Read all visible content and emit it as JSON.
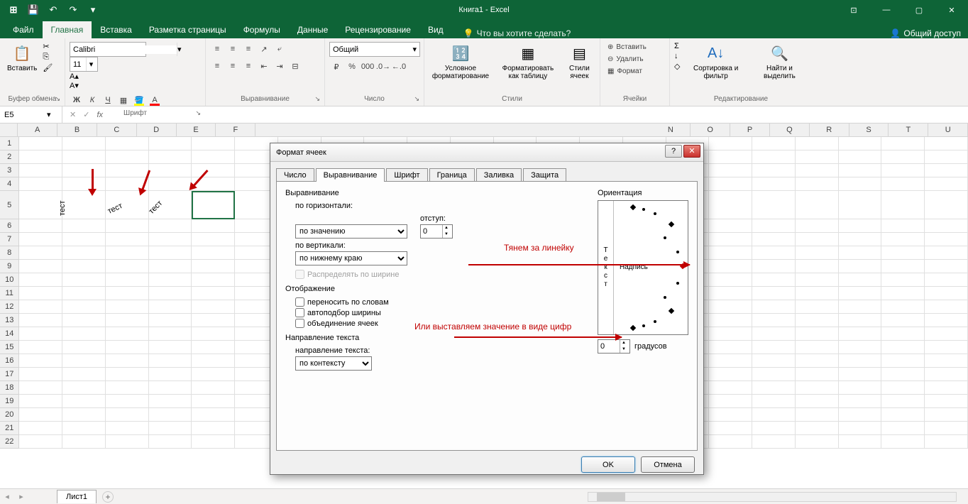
{
  "app": {
    "title": "Книга1 - Excel"
  },
  "qat": {
    "save": "💾",
    "undo": "↶",
    "redo": "↷"
  },
  "tabs": {
    "file": "Файл",
    "home": "Главная",
    "insert": "Вставка",
    "layout": "Разметка страницы",
    "formulas": "Формулы",
    "data": "Данные",
    "review": "Рецензирование",
    "view": "Вид",
    "tell": "Что вы хотите сделать?",
    "share": "Общий доступ"
  },
  "ribbon": {
    "clipboard": {
      "paste": "Вставить",
      "label": "Буфер обмена"
    },
    "font": {
      "name": "Calibri",
      "size": "11",
      "label": "Шрифт",
      "bold": "Ж",
      "italic": "К",
      "underline": "Ч"
    },
    "align": {
      "label": "Выравнивание",
      "wrap": "Перенести текст",
      "merge": "Объединить"
    },
    "number": {
      "format": "Общий",
      "label": "Число"
    },
    "styles": {
      "cond": "Условное форматирование",
      "table": "Форматировать как таблицу",
      "cell": "Стили ячеек",
      "label": "Стили"
    },
    "cells": {
      "insert": "Вставить",
      "delete": "Удалить",
      "format": "Формат",
      "label": "Ячейки"
    },
    "editing": {
      "sort": "Сортировка и фильтр",
      "find": "Найти и выделить",
      "label": "Редактирование"
    }
  },
  "fbar": {
    "name": "E5"
  },
  "columns": [
    "A",
    "B",
    "C",
    "D",
    "E",
    "F",
    "N",
    "O",
    "P",
    "Q",
    "R",
    "S",
    "T",
    "U"
  ],
  "rows": [
    "1",
    "2",
    "3",
    "4",
    "5",
    "6",
    "7",
    "8",
    "9",
    "10",
    "11",
    "12",
    "13",
    "14",
    "15",
    "16",
    "17",
    "18",
    "19",
    "20",
    "21",
    "22"
  ],
  "cells": {
    "b5": "тест",
    "c5": "тест",
    "d5": "тест"
  },
  "sheet": {
    "name": "Лист1"
  },
  "dialog": {
    "title": "Формат ячеек",
    "tabs": {
      "number": "Число",
      "align": "Выравнивание",
      "font": "Шрифт",
      "border": "Граница",
      "fill": "Заливка",
      "protect": "Защита"
    },
    "align_section": "Выравнивание",
    "horiz_label": "по горизонтали:",
    "horiz_val": "по значению",
    "indent_label": "отступ:",
    "indent_val": "0",
    "vert_label": "по вертикали:",
    "vert_val": "по нижнему краю",
    "distribute": "Распределять по ширине",
    "display_section": "Отображение",
    "wrap": "переносить по словам",
    "shrink": "автоподбор ширины",
    "merge": "объединение ячеек",
    "dir_section": "Направление текста",
    "dir_label": "направление текста:",
    "dir_val": "по контексту",
    "orient_title": "Ориентация",
    "orient_vtext": "Текст",
    "orient_nadpis": "Надпись",
    "degrees_val": "0",
    "degrees_label": "градусов",
    "ok": "OK",
    "cancel": "Отмена"
  },
  "anno": {
    "line1": "Тянем за линейку",
    "line2": "Или выставляем значение в виде цифр"
  }
}
